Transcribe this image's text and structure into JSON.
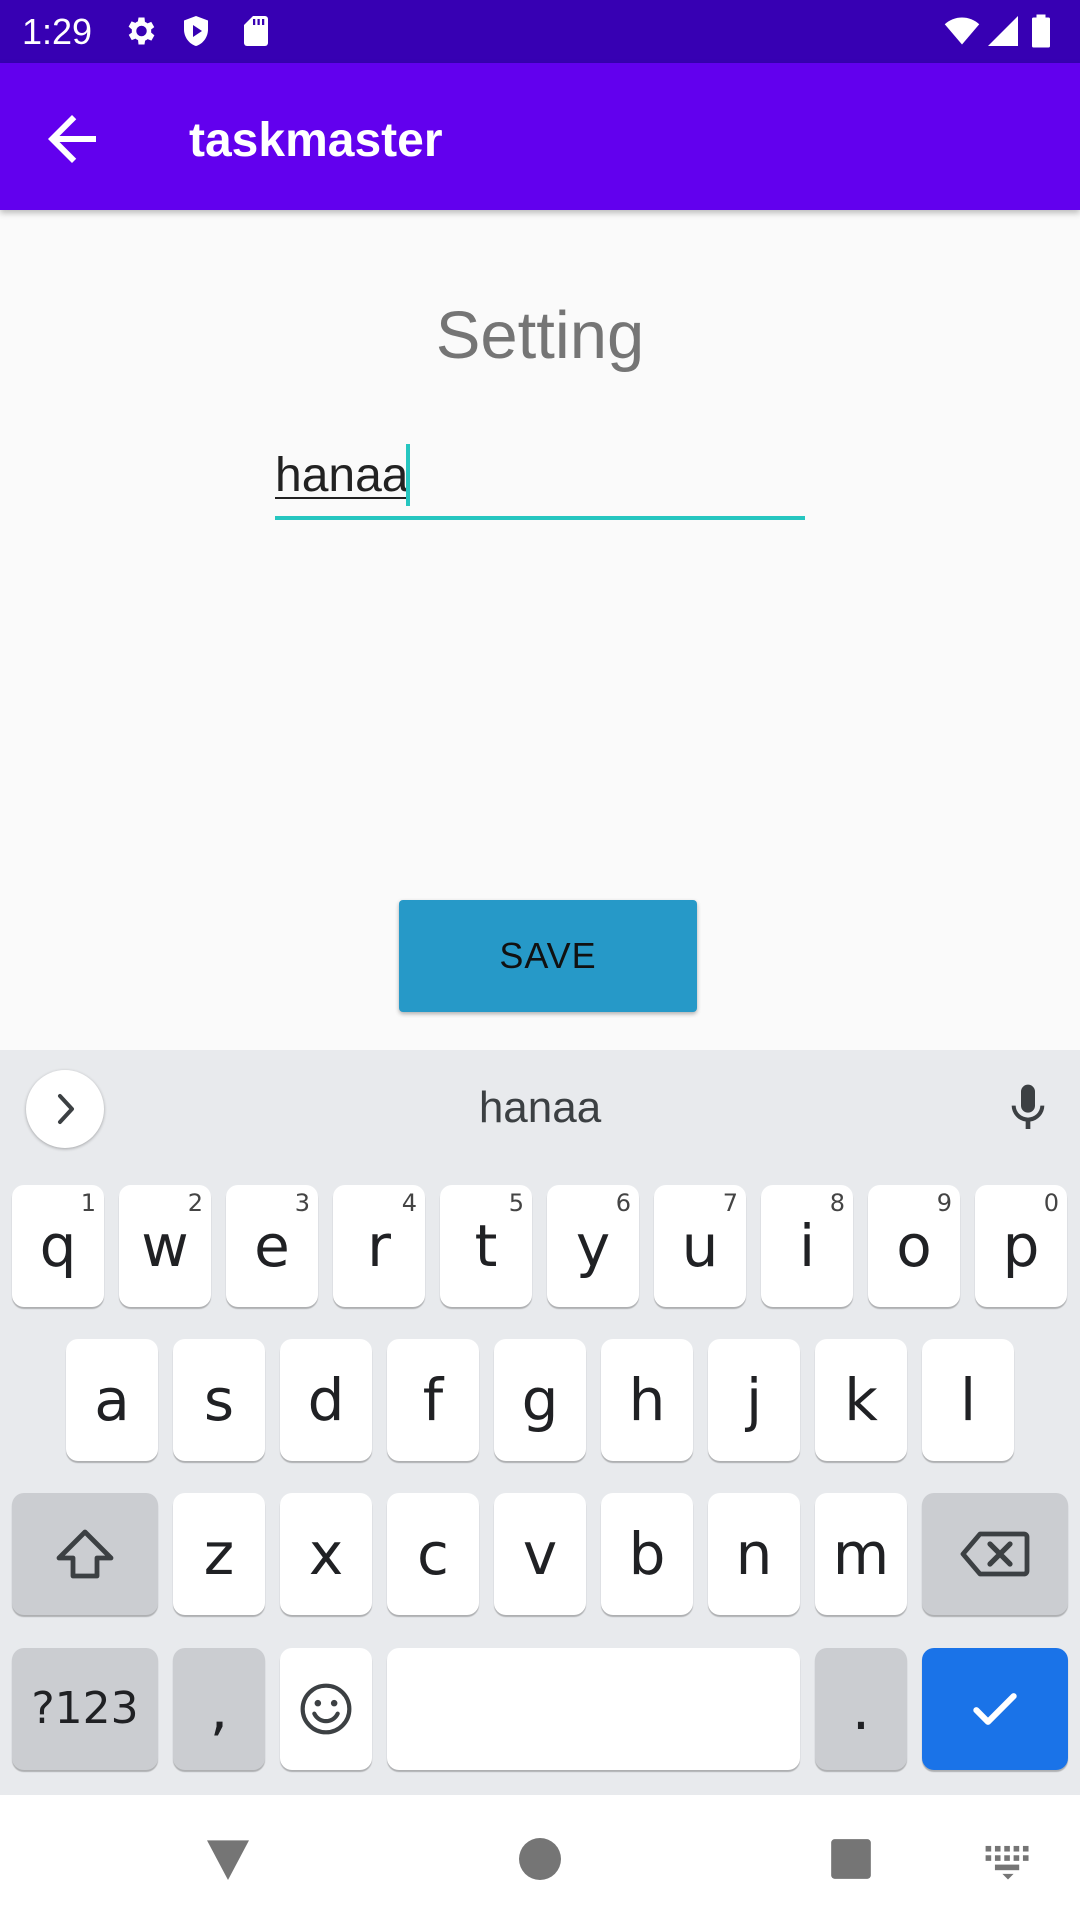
{
  "status_bar": {
    "time": "1:29",
    "icons": [
      "gear-icon",
      "shield-play-icon",
      "sd-card-icon",
      "wifi-icon",
      "signal-icon",
      "battery-icon"
    ]
  },
  "app_bar": {
    "title": "taskmaster",
    "back_icon": "arrow-back-icon"
  },
  "main": {
    "heading": "Setting",
    "username_value": "hanaa",
    "save_label": "SAVE"
  },
  "keyboard": {
    "suggestion": "hanaa",
    "row1": [
      {
        "label": "q",
        "hint": "1"
      },
      {
        "label": "w",
        "hint": "2"
      },
      {
        "label": "e",
        "hint": "3"
      },
      {
        "label": "r",
        "hint": "4"
      },
      {
        "label": "t",
        "hint": "5"
      },
      {
        "label": "y",
        "hint": "6"
      },
      {
        "label": "u",
        "hint": "7"
      },
      {
        "label": "i",
        "hint": "8"
      },
      {
        "label": "o",
        "hint": "9"
      },
      {
        "label": "p",
        "hint": "0"
      }
    ],
    "row2": [
      "a",
      "s",
      "d",
      "f",
      "g",
      "h",
      "j",
      "k",
      "l"
    ],
    "row3": [
      "z",
      "x",
      "c",
      "v",
      "b",
      "n",
      "m"
    ],
    "symbols_label": "?123",
    "comma_label": ",",
    "period_label": "."
  },
  "nav_bar": {
    "icons": [
      "back-triangle-icon",
      "home-circle-icon",
      "recents-square-icon",
      "keyboard-switch-icon"
    ]
  },
  "colors": {
    "status_bar": "#3700b3",
    "app_bar": "#6200ee",
    "accent": "#26c6c0",
    "save_button": "#2699c8",
    "keyboard_action": "#1a73e8"
  }
}
